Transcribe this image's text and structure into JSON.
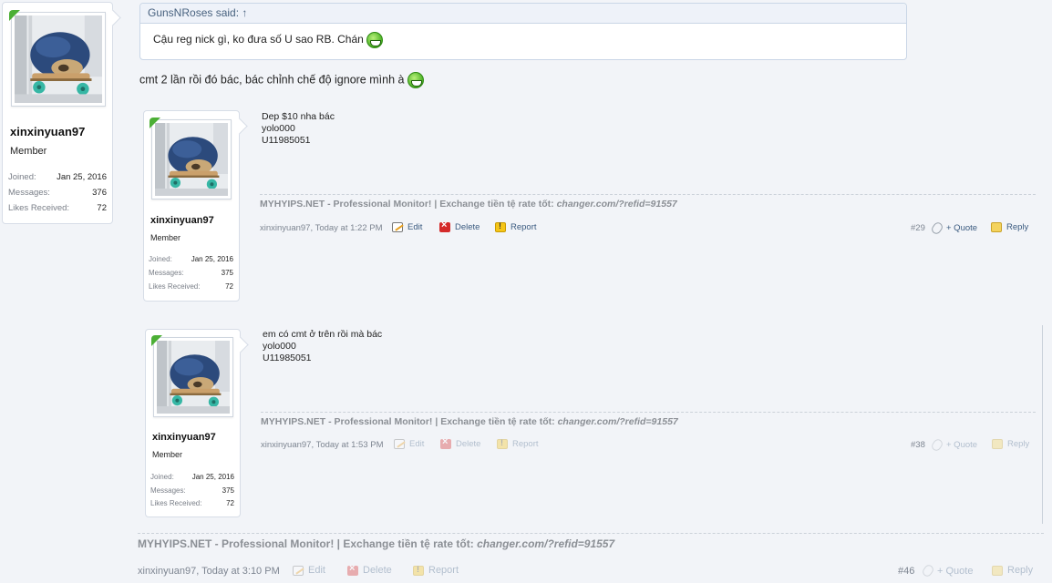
{
  "quote": {
    "header": "GunsNRoses said: ↑",
    "text": "Cậu reg nick gì, ko đưa số U sao RB. Chán"
  },
  "main_message": "cmt 2 lần rồi đó bác, bác chỉnh chế độ ignore mình à",
  "user": {
    "name": "xinxinyuan97",
    "title": "Member",
    "joined_label": "Joined:",
    "joined": "Jan 25, 2016",
    "messages_label": "Messages:",
    "messages_main": "376",
    "messages_nested": "375",
    "likes_label": "Likes Received:",
    "likes": "72"
  },
  "post29": {
    "lines": [
      "Dep $10 nha bác",
      "yolo000",
      "U11985051"
    ],
    "author_time": "xinxinyuan97, Today at 1:22 PM",
    "number": "#29"
  },
  "post38": {
    "lines": [
      "em có cmt ở trên rồi mà bác",
      "yolo000",
      "U11985051"
    ],
    "author_time": "xinxinyuan97, Today at 1:53 PM",
    "number": "#38"
  },
  "main_post": {
    "author_time": "xinxinyuan97, Today at 3:10 PM",
    "number": "#46"
  },
  "signature": {
    "prefix": "MYHYIPS.NET - Professional Monitor! | Exchange tiền tệ rate tốt: ",
    "link": "changer.com/?refid=91557"
  },
  "actions": {
    "edit": "Edit",
    "delete": "Delete",
    "report": "Report",
    "quote": "+ Quote",
    "reply": "Reply"
  },
  "colors": {
    "background": "#f2f4f8",
    "link": "#3b5b80",
    "online_badge": "#4caf35"
  }
}
